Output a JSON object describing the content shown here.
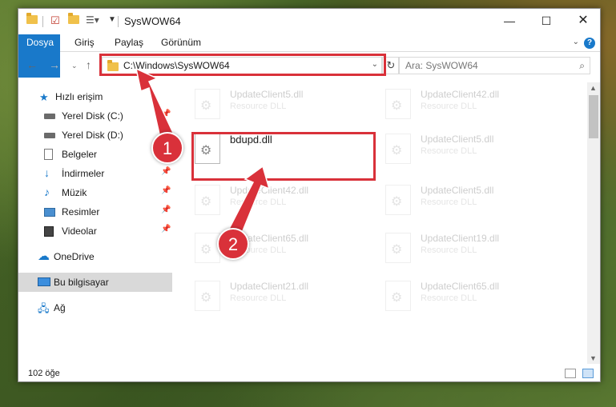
{
  "window": {
    "title": "SysWOW64"
  },
  "ribbon": {
    "tabs": [
      "Dosya",
      "Giriş",
      "Paylaş",
      "Görünüm"
    ]
  },
  "address": {
    "path": "C:\\Windows\\SysWOW64",
    "search_placeholder": "Ara: SysWOW64"
  },
  "sidebar": {
    "items": [
      {
        "label": "Hızlı erişim",
        "icon": "star-icon"
      },
      {
        "label": "Yerel Disk (C:)",
        "icon": "drive-icon"
      },
      {
        "label": "Yerel Disk (D:)",
        "icon": "drive-icon"
      },
      {
        "label": "Belgeler",
        "icon": "documents-icon"
      },
      {
        "label": "İndirmeler",
        "icon": "download-icon"
      },
      {
        "label": "Müzik",
        "icon": "music-icon"
      },
      {
        "label": "Resimler",
        "icon": "pictures-icon"
      },
      {
        "label": "Videolar",
        "icon": "videos-icon"
      },
      {
        "label": "OneDrive",
        "icon": "cloud-icon"
      },
      {
        "label": "Bu bilgisayar",
        "icon": "computer-icon"
      },
      {
        "label": "Ağ",
        "icon": "network-icon"
      }
    ]
  },
  "files": [
    {
      "name": "UpdateClient5.dll",
      "type": "Resource DLL"
    },
    {
      "name": "UpdateClient42.dll",
      "type": "Resource DLL"
    },
    {
      "name": "bdupd.dll",
      "type": ""
    },
    {
      "name": "UpdateClient5.dll",
      "type": "Resource DLL"
    },
    {
      "name": "UpdateClient42.dll",
      "type": "Resource DLL"
    },
    {
      "name": "UpdateClient5.dll",
      "type": "Resource DLL"
    },
    {
      "name": "UpdateClient65.dll",
      "type": "Resource DLL"
    },
    {
      "name": "UpdateClient19.dll",
      "type": "Resource DLL"
    },
    {
      "name": "UpdateClient21.dll",
      "type": "Resource DLL"
    },
    {
      "name": "UpdateClient65.dll",
      "type": "Resource DLL"
    }
  ],
  "status": {
    "count": "102 öğe"
  },
  "callouts": {
    "one": "1",
    "two": "2"
  },
  "colors": {
    "accent": "#1979ca",
    "highlight": "#d9313a",
    "folder": "#f0c14b"
  }
}
